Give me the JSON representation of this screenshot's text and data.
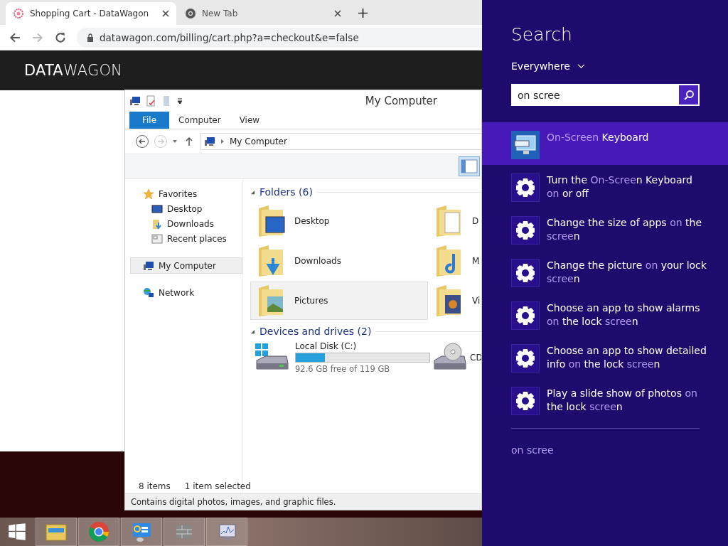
{
  "browser": {
    "tabs": [
      {
        "title": "Shopping Cart - DataWagon",
        "selected": true
      },
      {
        "title": "New Tab",
        "selected": false
      }
    ],
    "url": "datawagon.com/billing/cart.php?a=checkout&e=false",
    "logo": "**DATA**WAGON"
  },
  "explorer": {
    "title": "My Computer",
    "ribbon_tabs": [
      {
        "label": "File",
        "kind": "file"
      },
      {
        "label": "Computer",
        "kind": "tab"
      },
      {
        "label": "View",
        "kind": "tab"
      }
    ],
    "address": "My Computer",
    "nav": [
      {
        "label": "Favorites",
        "selected": false,
        "children": [
          {
            "label": "Desktop",
            "selected": false
          },
          {
            "label": "Downloads",
            "selected": false
          },
          {
            "label": "Recent places",
            "selected": false
          }
        ]
      },
      {
        "label": "My Computer",
        "selected": true
      },
      {
        "label": "Network",
        "selected": false
      }
    ],
    "folders": {
      "heading": "Folders (6)",
      "expanded": true,
      "items": [
        {
          "name": "Desktop",
          "selected": false
        },
        {
          "name": "D",
          "selected": false
        },
        {
          "name": "Downloads",
          "selected": false
        },
        {
          "name": "M",
          "selected": false
        },
        {
          "name": "Pictures",
          "selected": true
        },
        {
          "name": "Vi",
          "selected": false
        }
      ]
    },
    "drives": {
      "heading": "Devices and drives (2)",
      "expanded": true,
      "items": [
        {
          "kind": "disk",
          "name": "Local Disk (C:)",
          "level": 0.22,
          "free": "92.6 GB free of 119 GB"
        },
        {
          "kind": "cd",
          "name": "CD"
        }
      ]
    },
    "status": {
      "count": "8 items",
      "selection": "1 item selected"
    },
    "details": "Contains digital photos, images, and graphic files."
  },
  "search": {
    "title": "Search",
    "scope": "Everywhere",
    "query": "on scree",
    "results": [
      {
        "kind": "app",
        "selected": true,
        "segments": [
          {
            "text": "On-Screen",
            "match": true
          },
          {
            "text": " Keyboard",
            "match": false
          }
        ]
      },
      {
        "kind": "setting",
        "selected": false,
        "segments": [
          {
            "text": "Turn the ",
            "match": false
          },
          {
            "text": "On-Scree",
            "match": true
          },
          {
            "text": "n Keyboard ",
            "match": false
          },
          {
            "text": "on",
            "match": true
          },
          {
            "text": " or off",
            "match": false
          }
        ]
      },
      {
        "kind": "setting",
        "selected": false,
        "segments": [
          {
            "text": "Change the size of apps ",
            "match": false
          },
          {
            "text": "on",
            "match": true
          },
          {
            "text": " the ",
            "match": false
          },
          {
            "text": "scree",
            "match": true
          },
          {
            "text": "n",
            "match": false
          }
        ]
      },
      {
        "kind": "setting",
        "selected": false,
        "segments": [
          {
            "text": "Change the picture ",
            "match": false
          },
          {
            "text": "on",
            "match": true
          },
          {
            "text": " your lock ",
            "match": false
          },
          {
            "text": "scree",
            "match": true
          },
          {
            "text": "n",
            "match": false
          }
        ]
      },
      {
        "kind": "setting",
        "selected": false,
        "segments": [
          {
            "text": "Choose an app to show alarms ",
            "match": false
          },
          {
            "text": "on",
            "match": true
          },
          {
            "text": " the lock ",
            "match": false
          },
          {
            "text": "scree",
            "match": true
          },
          {
            "text": "n",
            "match": false
          }
        ]
      },
      {
        "kind": "setting",
        "selected": false,
        "segments": [
          {
            "text": "Choose an app to show detailed info ",
            "match": false
          },
          {
            "text": "on",
            "match": true
          },
          {
            "text": " the lock ",
            "match": false
          },
          {
            "text": "scree",
            "match": true
          },
          {
            "text": "n",
            "match": false
          }
        ]
      },
      {
        "kind": "setting",
        "selected": false,
        "segments": [
          {
            "text": "Play a slide show of photos ",
            "match": false
          },
          {
            "text": "on",
            "match": true
          },
          {
            "text": " the lock ",
            "match": false
          },
          {
            "text": "scree",
            "match": true
          },
          {
            "text": "n",
            "match": false
          }
        ]
      }
    ],
    "footer": "on scree"
  }
}
